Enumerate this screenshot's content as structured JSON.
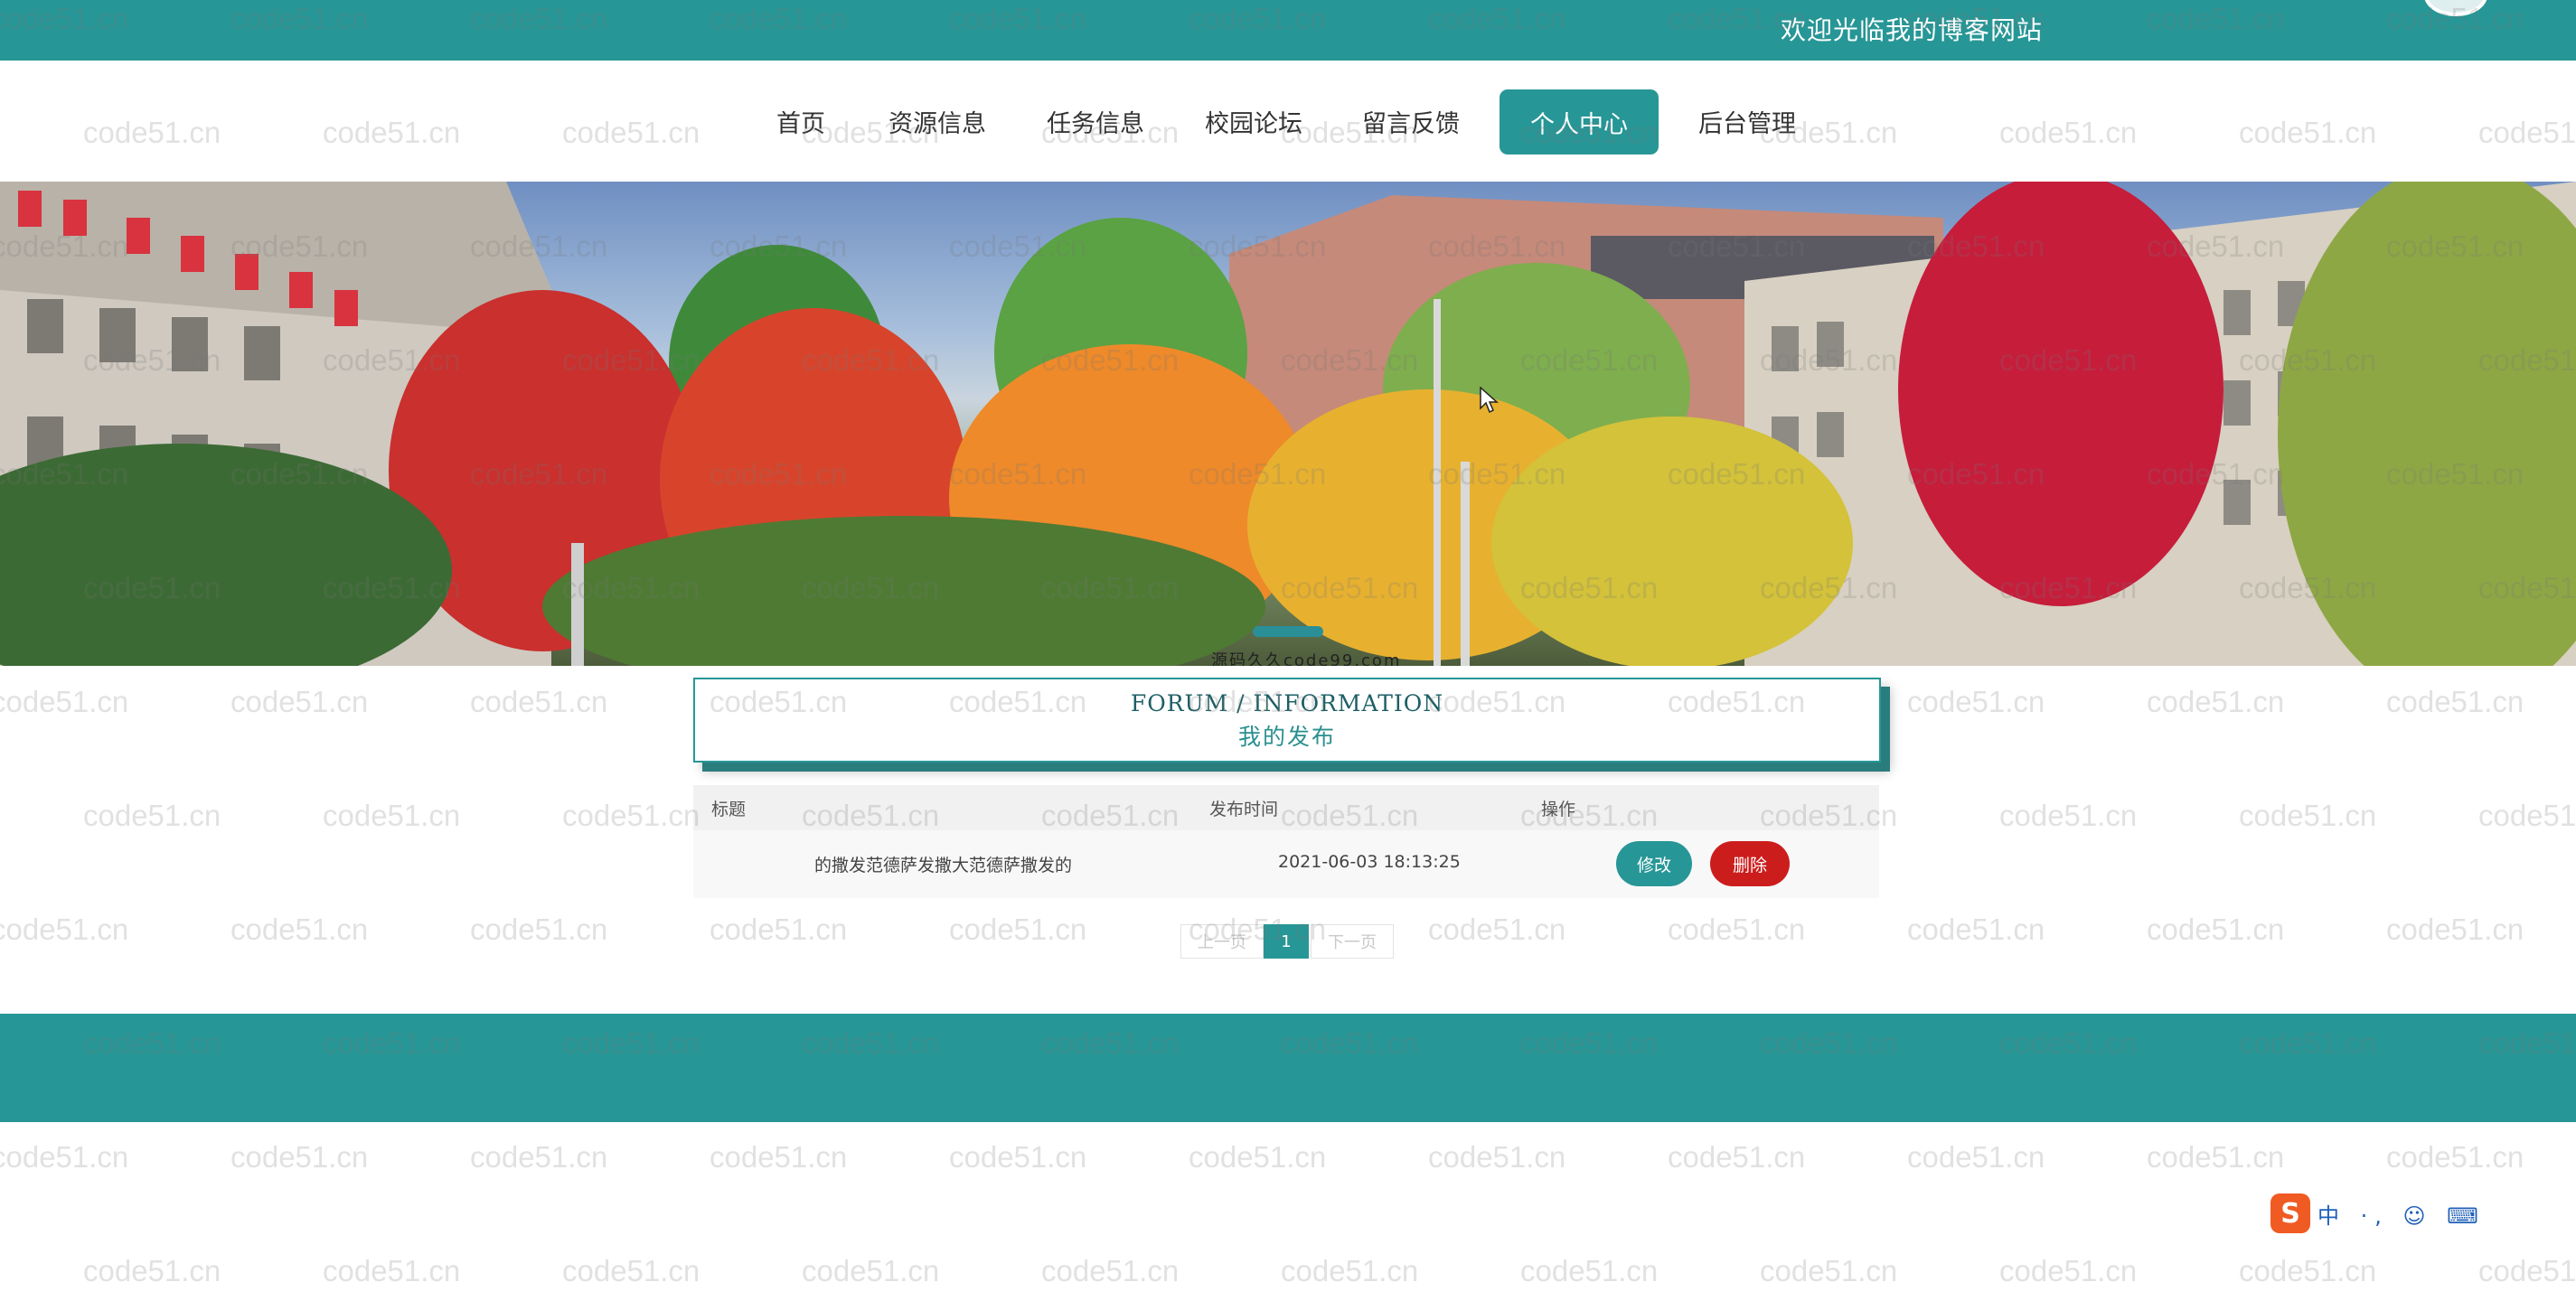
{
  "header": {
    "welcome": "欢迎光临我的博客网站"
  },
  "nav": {
    "items": [
      {
        "label": "首页",
        "active": false
      },
      {
        "label": "资源信息",
        "active": false
      },
      {
        "label": "任务信息",
        "active": false
      },
      {
        "label": "校园论坛",
        "active": false
      },
      {
        "label": "留言反馈",
        "active": false
      },
      {
        "label": "个人中心",
        "active": true
      },
      {
        "label": "后台管理",
        "active": false
      }
    ]
  },
  "banner": {
    "caption": "源码久久code99.com"
  },
  "section": {
    "title_en": "FORUM / INFORMATION",
    "title_cn": "我的发布"
  },
  "table": {
    "headers": [
      "标题",
      "发布时间",
      "操作"
    ],
    "rows": [
      {
        "title": "的撒发范德萨发撒大范德萨撒发的",
        "time": "2021-06-03 18:13:25",
        "edit_label": "修改",
        "delete_label": "删除"
      }
    ]
  },
  "pagination": {
    "prev": "上一页",
    "current": "1",
    "next": "下一页"
  },
  "ime": {
    "logo": "S",
    "text": "中 ·, ☺ ⌨"
  },
  "watermark": "code51.cn",
  "colors": {
    "primary": "#279696",
    "danger": "#cc1d1d"
  }
}
